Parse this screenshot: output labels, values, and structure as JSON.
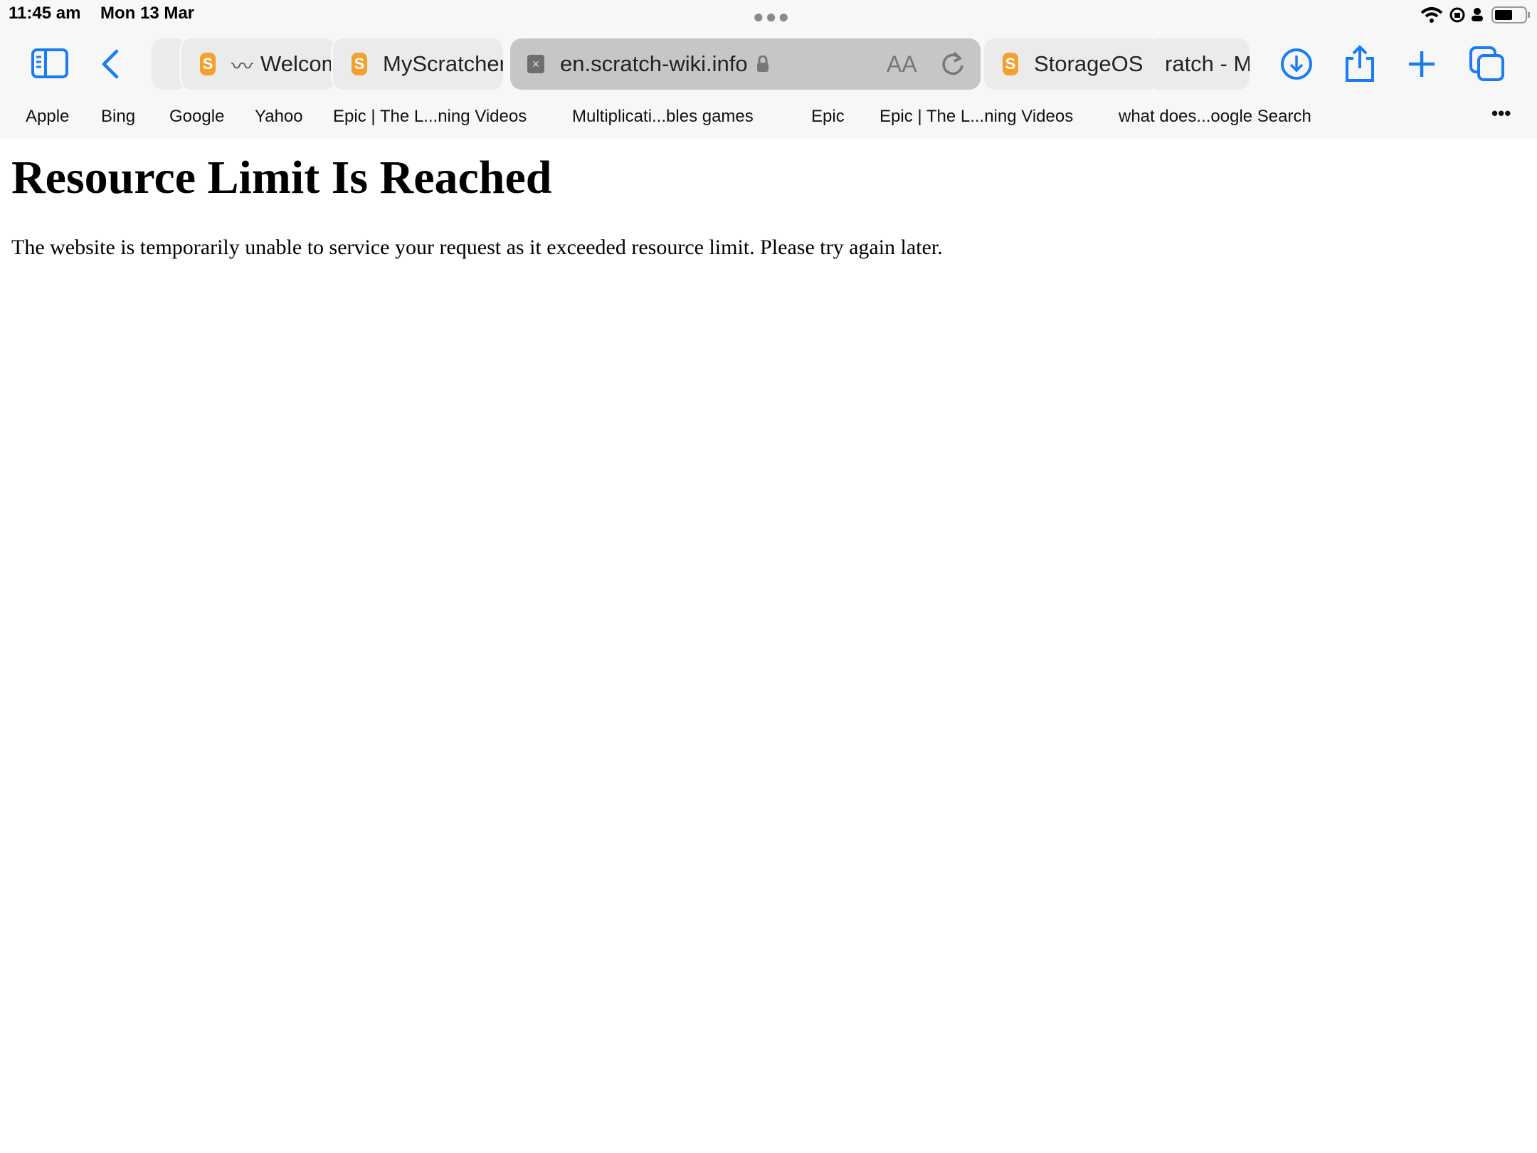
{
  "status_bar": {
    "time": "11:45 am",
    "date": "Mon 13 Mar",
    "battery_level": 0.6
  },
  "toolbar": {
    "tabs": [
      {
        "title": "Welcome",
        "favicon": "scratch-icon"
      },
      {
        "title": "MyScratcher",
        "favicon": "scratch-icon"
      },
      {
        "title": "en.scratch-wiki.info",
        "active": true
      },
      {
        "title": "StorageOS",
        "favicon": "scratch-icon"
      },
      {
        "title": "ratch - M"
      }
    ],
    "reader_label": "AA"
  },
  "bookmarks": [
    "Apple",
    "Bing",
    "Google",
    "Yahoo",
    "Epic | The L...ning Videos",
    "Multiplicati...bles games",
    "Epic",
    "Epic | The L...ning Videos",
    "what does...oogle Search"
  ],
  "page": {
    "heading": "Resource Limit Is Reached",
    "message": "The website is temporarily unable to service your request as it exceeded resource limit. Please try again later."
  },
  "colors": {
    "accent": "#1a7cf5",
    "favicon": "#f5a02e"
  }
}
